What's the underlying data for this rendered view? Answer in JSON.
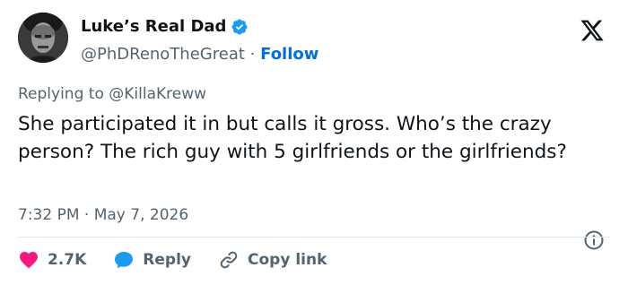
{
  "author": {
    "display_name": "Luke’s Real Dad",
    "handle": "@PhDRenoTheGreat",
    "separator": "·",
    "follow_label": "Follow",
    "verified": true
  },
  "reply_context": {
    "prefix": "Replying to",
    "mention": "@KillaKreww"
  },
  "tweet": {
    "text": "She participated it in but calls it gross. Who’s the crazy person? The rich guy with 5 girlfriends or the girlfriends?",
    "time": "7:32 PM",
    "separator": "·",
    "date": "May 7, 2026"
  },
  "actions": {
    "like_count": "2.7K",
    "reply_label": "Reply",
    "copy_label": "Copy link"
  },
  "colors": {
    "accent": "#1d9bf0",
    "follow": "#006fd6",
    "like": "#f91880",
    "muted": "#536471",
    "text": "#0f1419"
  },
  "icons": {
    "verified": "verified-badge-icon",
    "brand": "x-logo-icon",
    "info": "info-icon",
    "like": "heart-icon",
    "reply": "speech-bubble-icon",
    "copy": "link-icon"
  }
}
